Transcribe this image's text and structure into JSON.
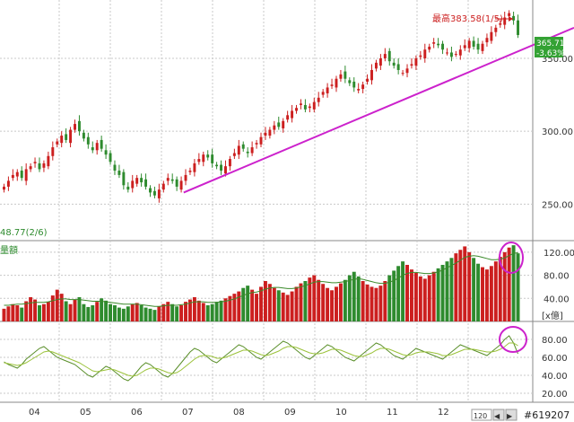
{
  "chart_data": [
    {
      "type": "candlestick",
      "panel": "price",
      "title": "",
      "ylim": [
        225,
        390
      ],
      "y_ticks": [
        250.0,
        300.0,
        350.0
      ],
      "y_tick_labels": [
        "250.00",
        "300.00",
        "350.00"
      ],
      "grid": true,
      "x_labels": [
        "04",
        "05",
        "06",
        "07",
        "08",
        "09",
        "10",
        "11",
        "12"
      ],
      "high_annotation": "最高383.58(1/5)",
      "low_annotation": "48.77(2/6)",
      "last_price_label": "365.71",
      "last_change_label": "-3.63%",
      "trendline": [
        {
          "x": 0.3,
          "y": 258
        },
        {
          "x": 1.0,
          "y": 371
        }
      ],
      "colors": {
        "up": "#cc1f1f",
        "down": "#2e8b2e",
        "trendline": "#cc22cc",
        "last_price_bg": "#34a234"
      },
      "candles_close": [
        262,
        266,
        270,
        272,
        268,
        274,
        276,
        279,
        274,
        278,
        283,
        289,
        293,
        297,
        294,
        301,
        305,
        300,
        295,
        291,
        287,
        292,
        288,
        284,
        279,
        273,
        270,
        263,
        260,
        266,
        268,
        265,
        262,
        258,
        256,
        260,
        264,
        268,
        266,
        262,
        266,
        270,
        273,
        278,
        281,
        284,
        282,
        278,
        276,
        273,
        276,
        281,
        285,
        290,
        288,
        285,
        289,
        292,
        296,
        299,
        301,
        304,
        303,
        307,
        311,
        314,
        316,
        319,
        315,
        317,
        320,
        323,
        327,
        330,
        332,
        336,
        339,
        336,
        333,
        330,
        329,
        332,
        336,
        342,
        347,
        350,
        353,
        348,
        345,
        342,
        340,
        343,
        346,
        350,
        352,
        356,
        358,
        361,
        359,
        356,
        354,
        351,
        353,
        356,
        359,
        362,
        358,
        356,
        360,
        364,
        368,
        371,
        374,
        378,
        381,
        376,
        366
      ]
    },
    {
      "type": "bar",
      "panel": "volume",
      "label": "量額",
      "ylim": [
        0,
        140
      ],
      "y_ticks": [
        40.0,
        80.0,
        120.0
      ],
      "y_tick_labels": [
        "40.00",
        "80.00",
        "120.00"
      ],
      "unit_label": "[x億]",
      "values": [
        22,
        26,
        30,
        28,
        24,
        35,
        42,
        38,
        28,
        30,
        34,
        45,
        55,
        48,
        35,
        30,
        38,
        42,
        30,
        25,
        28,
        34,
        40,
        36,
        30,
        28,
        24,
        22,
        26,
        30,
        32,
        28,
        24,
        22,
        20,
        26,
        30,
        34,
        30,
        26,
        28,
        34,
        38,
        42,
        36,
        32,
        28,
        30,
        34,
        36,
        40,
        44,
        48,
        52,
        58,
        62,
        55,
        48,
        60,
        70,
        65,
        58,
        54,
        50,
        46,
        52,
        60,
        66,
        70,
        76,
        80,
        72,
        65,
        58,
        54,
        60,
        66,
        72,
        80,
        86,
        78,
        70,
        64,
        60,
        58,
        62,
        70,
        80,
        88,
        96,
        104,
        98,
        90,
        84,
        78,
        74,
        80,
        86,
        92,
        98,
        104,
        110,
        118,
        124,
        130,
        120,
        110,
        100,
        94,
        90,
        96,
        104,
        112,
        120,
        128,
        132,
        118
      ],
      "ma": [
        28,
        28,
        29,
        30,
        30,
        31,
        32,
        33,
        33,
        33,
        34,
        36,
        38,
        39,
        39,
        38,
        38,
        38,
        37,
        36,
        35,
        35,
        35,
        34,
        33,
        32,
        31,
        30,
        30,
        30,
        30,
        29,
        28,
        27,
        26,
        26,
        27,
        28,
        28,
        28,
        29,
        30,
        32,
        34,
        34,
        34,
        33,
        33,
        33,
        34,
        35,
        37,
        39,
        42,
        45,
        48,
        50,
        51,
        53,
        56,
        58,
        59,
        59,
        58,
        57,
        57,
        58,
        60,
        62,
        65,
        68,
        69,
        69,
        68,
        67,
        67,
        68,
        69,
        71,
        73,
        74,
        73,
        71,
        69,
        67,
        66,
        66,
        68,
        71,
        75,
        80,
        83,
        85,
        85,
        84,
        83,
        83,
        84,
        86,
        89,
        93,
        97,
        101,
        106,
        111,
        113,
        114,
        113,
        111,
        109,
        107,
        107,
        108,
        110,
        114,
        118,
        119
      ]
    },
    {
      "type": "line",
      "panel": "oscillator",
      "ylim": [
        10,
        100
      ],
      "y_ticks": [
        20.0,
        40.0,
        60.0,
        80.0
      ],
      "y_tick_labels": [
        "20.00",
        "40.00",
        "60.00",
        "80.00"
      ],
      "series": [
        {
          "values": [
            55,
            52,
            50,
            48,
            52,
            58,
            62,
            66,
            70,
            72,
            68,
            64,
            60,
            58,
            56,
            54,
            52,
            48,
            44,
            40,
            38,
            42,
            46,
            50,
            48,
            44,
            40,
            36,
            34,
            38,
            44,
            50,
            54,
            52,
            48,
            44,
            40,
            38,
            42,
            48,
            54,
            60,
            66,
            70,
            68,
            64,
            60,
            56,
            54,
            58,
            62,
            66,
            70,
            74,
            72,
            68,
            64,
            60,
            58,
            62,
            66,
            70,
            74,
            78,
            76,
            72,
            68,
            64,
            60,
            58,
            62,
            66,
            70,
            74,
            72,
            68,
            64,
            60,
            58,
            56,
            60,
            64,
            68,
            72,
            76,
            74,
            70,
            66,
            62,
            60,
            58,
            62,
            66,
            70,
            68,
            66,
            64,
            62,
            60,
            58,
            62,
            66,
            70,
            74,
            72,
            70,
            68,
            66,
            64,
            62,
            66,
            70,
            74,
            80,
            84,
            76,
            64
          ]
        },
        {
          "values": [
            54,
            53,
            52,
            51,
            52,
            54,
            57,
            60,
            63,
            66,
            67,
            66,
            64,
            62,
            60,
            58,
            56,
            54,
            51,
            48,
            45,
            44,
            45,
            46,
            47,
            46,
            44,
            42,
            40,
            39,
            40,
            43,
            46,
            48,
            48,
            47,
            45,
            43,
            42,
            43,
            46,
            50,
            54,
            58,
            61,
            62,
            62,
            61,
            59,
            59,
            60,
            62,
            64,
            66,
            68,
            68,
            67,
            65,
            63,
            62,
            63,
            65,
            67,
            70,
            72,
            72,
            71,
            69,
            67,
            65,
            64,
            64,
            65,
            67,
            69,
            69,
            68,
            66,
            64,
            62,
            61,
            61,
            63,
            65,
            68,
            70,
            70,
            69,
            67,
            65,
            63,
            62,
            63,
            65,
            66,
            66,
            66,
            65,
            64,
            62,
            62,
            63,
            65,
            67,
            69,
            69,
            69,
            68,
            67,
            66,
            66,
            67,
            69,
            72,
            76,
            76,
            73
          ]
        }
      ],
      "colors": {
        "primary": "#5a8f2a",
        "secondary": "#9bc23a"
      }
    }
  ],
  "watermark": "#619207",
  "bottom_controls": [
    "120",
    "◀",
    "▶"
  ],
  "colors": {
    "grid": "#c8c8c8",
    "axis_text": "#333333",
    "annotation_red": "#cc1f1f",
    "highlight_circle": "#cc22cc"
  }
}
